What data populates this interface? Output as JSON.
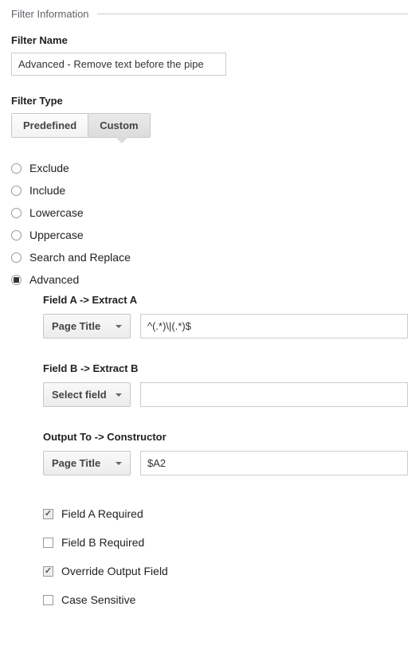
{
  "section_title": "Filter Information",
  "filter_name": {
    "label": "Filter Name",
    "value": "Advanced - Remove text before the pipe"
  },
  "filter_type": {
    "label": "Filter Type",
    "predefined": "Predefined",
    "custom": "Custom",
    "selected": "Custom"
  },
  "radios": {
    "exclude": "Exclude",
    "include": "Include",
    "lowercase": "Lowercase",
    "uppercase": "Uppercase",
    "search_replace": "Search and Replace",
    "advanced": "Advanced"
  },
  "advanced": {
    "field_a": {
      "title": "Field A -> Extract A",
      "select": "Page Title",
      "regex": "^(.*)\\|(.*)$"
    },
    "field_b": {
      "title": "Field B -> Extract B",
      "select": "Select field",
      "regex": ""
    },
    "output": {
      "title": "Output To -> Constructor",
      "select": "Page Title",
      "value": "$A2"
    },
    "checks": {
      "field_a_req": "Field A Required",
      "field_b_req": "Field B Required",
      "override": "Override Output Field",
      "case_sensitive": "Case Sensitive"
    }
  }
}
